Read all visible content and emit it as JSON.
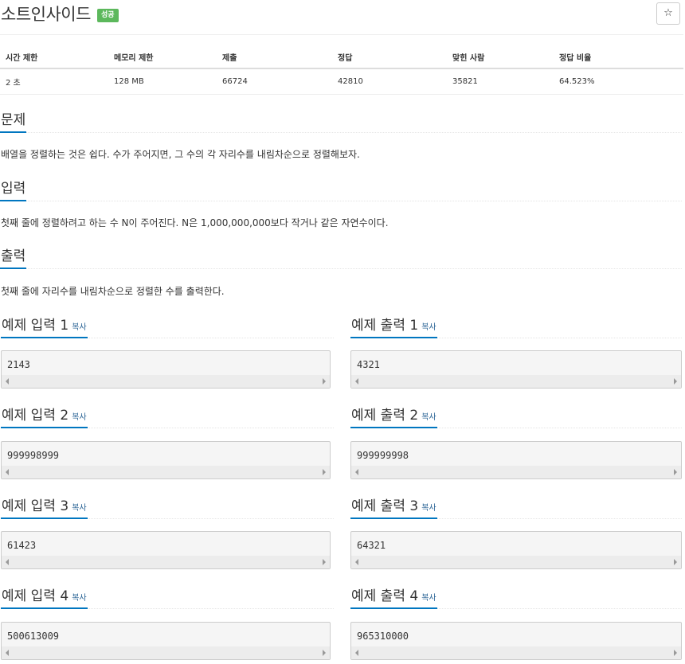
{
  "header": {
    "title": "소트인사이드",
    "badge": "성공",
    "star_icon": "☆"
  },
  "stats": {
    "headers": [
      "시간 제한",
      "메모리 제한",
      "제출",
      "정답",
      "맞힌 사람",
      "정답 비율"
    ],
    "values": [
      "2 초",
      "128 MB",
      "66724",
      "42810",
      "35821",
      "64.523%"
    ]
  },
  "sections": {
    "problem": {
      "title": "문제",
      "text": "배열을 정렬하는 것은 쉽다. 수가 주어지면, 그 수의 각 자리수를 내림차순으로 정렬해보자."
    },
    "input": {
      "title": "입력",
      "text": "첫째 줄에 정렬하려고 하는 수 N이 주어진다. N은 1,000,000,000보다 작거나 같은 자연수이다."
    },
    "output": {
      "title": "출력",
      "text": "첫째 줄에 자리수를 내림차순으로 정렬한 수를 출력한다."
    }
  },
  "copy_label": "복사",
  "samples": [
    {
      "input_title": "예제 입력 1",
      "input": "2143",
      "output_title": "예제 출력 1",
      "output": "4321"
    },
    {
      "input_title": "예제 입력 2",
      "input": "999998999",
      "output_title": "예제 출력 2",
      "output": "999999998"
    },
    {
      "input_title": "예제 입력 3",
      "input": "61423",
      "output_title": "예제 출력 3",
      "output": "64321"
    },
    {
      "input_title": "예제 입력 4",
      "input": "500613009",
      "output_title": "예제 출력 4",
      "output": "965310000"
    }
  ]
}
